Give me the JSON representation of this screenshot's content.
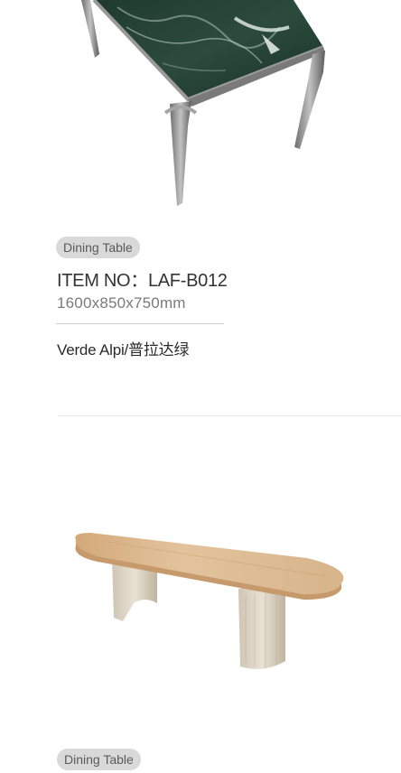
{
  "products": [
    {
      "image_name": "green-marble-dining-table",
      "category": "Dining Table",
      "item_label": "ITEM NO：",
      "item_code": "LAF-B012",
      "dimensions": "1600x850x750mm",
      "material": "Verde Alpi/普拉达绿"
    },
    {
      "image_name": "travertine-oval-dining-table",
      "category": "Dining Table"
    }
  ]
}
